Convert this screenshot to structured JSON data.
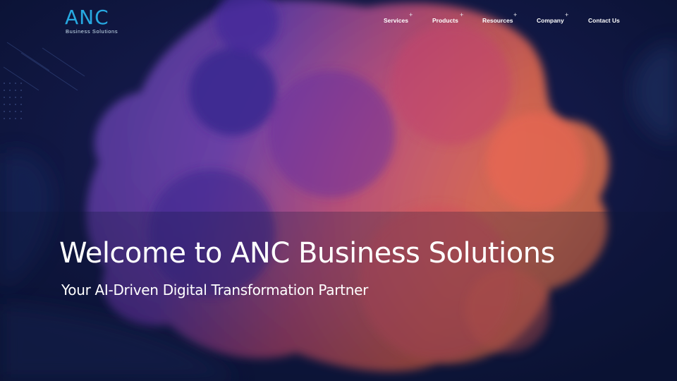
{
  "header": {
    "logo": {
      "mark": "ANC",
      "tagline": "Business Solutions"
    },
    "nav": [
      {
        "label": "Services",
        "has_submenu": true
      },
      {
        "label": "Products",
        "has_submenu": true
      },
      {
        "label": "Resources",
        "has_submenu": true
      },
      {
        "label": "Company",
        "has_submenu": true
      },
      {
        "label": "Contact Us",
        "has_submenu": false
      }
    ],
    "submenu_indicator": "+"
  },
  "hero": {
    "title": "Welcome to ANC Business Solutions",
    "subtitle": "Your AI-Driven Digital Transformation Partner"
  },
  "colors": {
    "background": "#0b1437",
    "logo_accent": "#27a9e1",
    "blob_purple": "#4a2aa0",
    "blob_orange": "#e0574a",
    "text": "#ffffff"
  }
}
